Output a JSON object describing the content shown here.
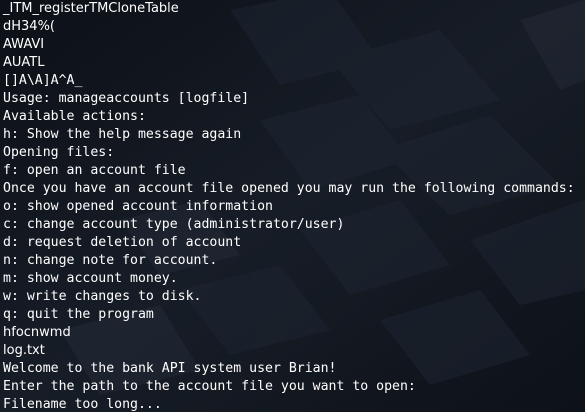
{
  "terminal": {
    "lines": [
      "_ITM_registerTMCloneTable",
      "dH34%(",
      "AWAVI",
      "AUATL",
      "[]A\\A]A^A_",
      "Usage: manageaccounts [logfile]",
      "Available actions:",
      "h: Show the help message again",
      "Opening files:",
      "f: open an account file",
      "Once you have an account file opened you may run the following commands:",
      "o: show opened account information",
      "c: change account type (administrator/user)",
      "d: request deletion of account",
      "n: change note for account.",
      "m: show account money.",
      "w: write changes to disk.",
      "q: quit the program",
      "hfocnwmd",
      "log.txt",
      "Welcome to the bank API system user Brian!",
      "Enter the path to the account file you want to open:",
      "Filename too long..."
    ],
    "colors": {
      "background": "#10151d",
      "text": "#ffffff"
    }
  }
}
